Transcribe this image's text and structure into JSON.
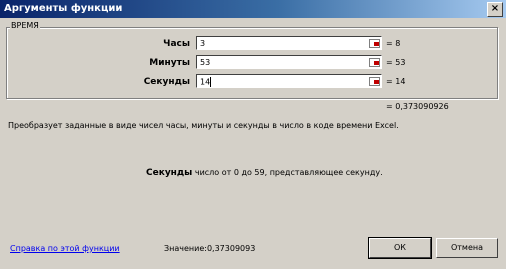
{
  "window": {
    "title": "Аргументы функции",
    "close_glyph": "×"
  },
  "group": {
    "title": "ВРЕМЯ"
  },
  "args": [
    {
      "label": "Часы",
      "value": "3",
      "result": "= 8"
    },
    {
      "label": "Минуты",
      "value": "53",
      "result": "= 53"
    },
    {
      "label": "Секунды",
      "value": "14",
      "result": "= 14"
    }
  ],
  "total_result": "= 0,373090926",
  "description": "Преобразует заданные в виде чисел часы, минуты и секунды в число в коде времени Excel.",
  "arg_help": {
    "name": "Секунды",
    "text": "число от 0 до 59, представляющее секунду."
  },
  "help_link": "Справка по этой функции",
  "formula_result": "Значение:0,37309093",
  "buttons": {
    "ok": "ОК",
    "cancel": "Отмена"
  },
  "icons": {
    "ref": "collapse-dialog-icon"
  }
}
